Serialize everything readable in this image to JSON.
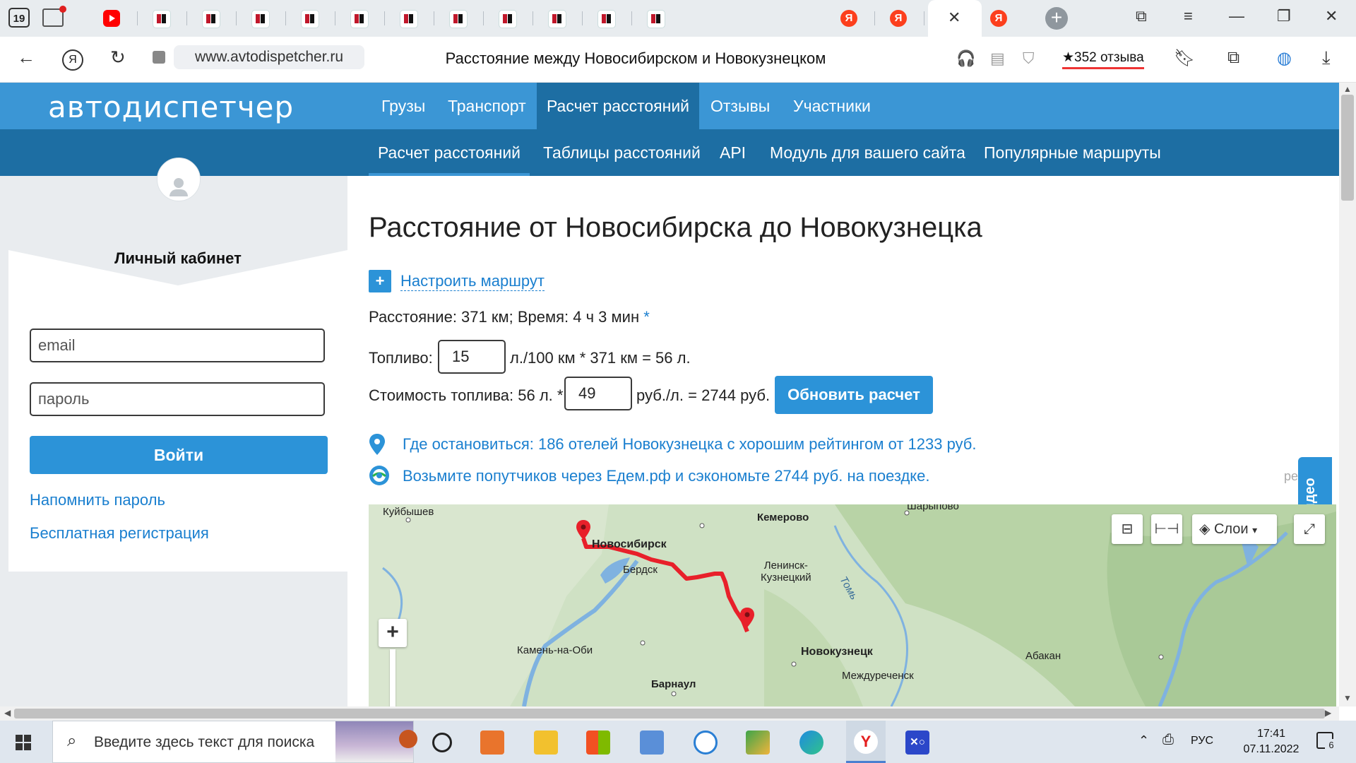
{
  "browser": {
    "tab_count": "19",
    "tabs": [
      {
        "icon": "youtube-icon"
      },
      {
        "icon": "avtodispetcher-icon"
      },
      {
        "icon": "avtodispetcher-icon"
      },
      {
        "icon": "avtodispetcher-icon"
      },
      {
        "icon": "avtodispetcher-icon"
      },
      {
        "icon": "avtodispetcher-icon"
      },
      {
        "icon": "avtodispetcher-icon"
      },
      {
        "icon": "avtodispetcher-icon"
      },
      {
        "icon": "avtodispetcher-icon"
      },
      {
        "icon": "avtodispetcher-icon"
      },
      {
        "icon": "avtodispetcher-icon"
      },
      {
        "icon": "avtodispetcher-icon"
      },
      {
        "icon": "yandex-icon",
        "glyph": "Я"
      },
      {
        "icon": "yandex-icon",
        "glyph": "Я"
      },
      {
        "icon": "yandex-icon",
        "glyph": "Я"
      }
    ],
    "url": "www.avtodispetcher.ru",
    "page_title": "Расстояние между Новосибирском и Новокузнецком",
    "reviews": "★352 отзыва"
  },
  "site": {
    "logo": "автодиспетчер",
    "nav_primary": [
      "Грузы",
      "Транспорт",
      "Расчет расстояний",
      "Отзывы",
      "Участники"
    ],
    "nav_secondary": [
      "Расчет расстояний",
      "Таблицы расстояний",
      "API",
      "Модуль для вашего сайта",
      "Популярные маршруты"
    ]
  },
  "sidebar": {
    "title": "Личный кабинет",
    "email_placeholder": "email",
    "password_placeholder": "пароль",
    "login_button": "Войти",
    "remind_link": "Напомнить пароль",
    "register_link": "Бесплатная регистрация"
  },
  "main": {
    "heading": "Расстояние от Новосибирска до Новокузнецка",
    "route_button": "+",
    "route_link": "Настроить маршрут",
    "distance_line": "Расстояние: 371 км; Время: 4 ч 3 мин",
    "asterisk": "*",
    "fuel_label": "Топливо:",
    "fuel_value": "15",
    "fuel_formula": "л./100 км * 371 км = 56 л.",
    "cost_label": "Стоимость топлива: 56 л. *",
    "cost_value": "49",
    "cost_formula": "руб./л. = 2744 руб.",
    "update_button": "Обновить расчет",
    "hotels_link": "Где остановиться: 186 отелей Новокузнецка с хорошим рейтингом от 1233 руб.",
    "edem_link": "Возьмите попутчиков через Едем.рф и сэкономьте 2744 руб. на поездке.",
    "side_tab": "Видео",
    "side_fragment": "ре"
  },
  "map": {
    "labels": {
      "kuibyshev": "Куйбышев",
      "kemerovo": "Кемерово",
      "sharypovo": "Шарыпово",
      "novosibirsk": "Новосибирск",
      "berdsk": "Бердск",
      "leninsk": "Ленинск-\nКузнецкий",
      "tom": "Томь",
      "kamen": "Камень-на-Оби",
      "novokuznetsk": "Новокузнецк",
      "mezhdurechensk": "Междуреченск",
      "abakan": "Абакан",
      "barnaul": "Барнаул"
    },
    "layers_label": "Слои",
    "zoom_in": "+",
    "route_color": "#e8202a",
    "marker_color": "#e8202a"
  },
  "taskbar": {
    "search_placeholder": "Введите здесь текст для поиска",
    "language": "РУС",
    "time": "17:41",
    "date": "07.11.2022",
    "notifications": "6"
  }
}
